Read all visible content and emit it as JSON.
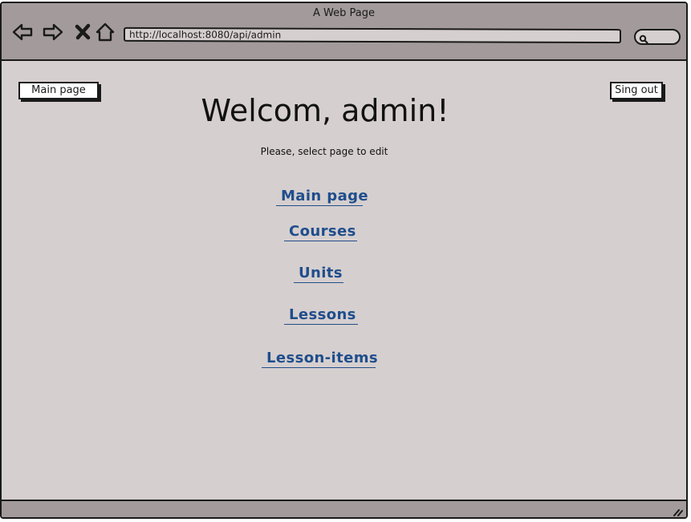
{
  "window": {
    "title": "A Web Page",
    "url": "http://localhost:8080/api/admin",
    "icons": {
      "back": "back-arrow-icon",
      "forward": "forward-arrow-icon",
      "close": "close-icon",
      "home": "home-icon",
      "search": "search-icon",
      "resize": "resize-grip-icon"
    }
  },
  "header": {
    "main_page_button": "Main page",
    "sign_out_button": "Sing out"
  },
  "main": {
    "title": "Welcom, admin!",
    "subtitle": "Please, select page to edit",
    "links": [
      "Main page",
      "Courses",
      "Units",
      "Lessons",
      "Lesson-items"
    ]
  },
  "colors": {
    "chrome": "#a39b9b",
    "content_bg": "#d6cfcf",
    "link": "#1f4e8c"
  }
}
